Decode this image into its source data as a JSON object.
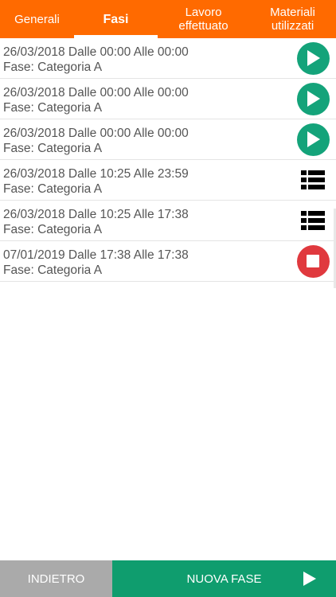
{
  "tabs": [
    {
      "label": "Generali"
    },
    {
      "label": "Fasi"
    },
    {
      "label": "Lavoro effettuato"
    },
    {
      "label": "Materiali utilizzati"
    }
  ],
  "active_tab": "Fasi",
  "colors": {
    "header": "#ff6a00",
    "play": "#14a37a",
    "stop": "#e0393e",
    "back_button": "#aaaaaa",
    "new_button": "#0f9d6e"
  },
  "phases": [
    {
      "line1": "26/03/2018 Dalle 00:00 Alle 00:00",
      "line2": "Fase: Categoria A",
      "action_icon": "play-icon"
    },
    {
      "line1": "26/03/2018 Dalle 00:00 Alle 00:00",
      "line2": "Fase: Categoria A",
      "action_icon": "play-icon"
    },
    {
      "line1": "26/03/2018 Dalle 00:00 Alle 00:00",
      "line2": "Fase: Categoria A",
      "action_icon": "play-icon"
    },
    {
      "line1": "26/03/2018 Dalle 10:25 Alle 23:59",
      "line2": "Fase: Categoria A",
      "action_icon": "list-icon"
    },
    {
      "line1": "26/03/2018 Dalle 10:25 Alle 17:38",
      "line2": "Fase: Categoria A",
      "action_icon": "list-icon"
    },
    {
      "line1": "07/01/2019 Dalle 17:38 Alle 17:38",
      "line2": "Fase: Categoria A",
      "action_icon": "stop-icon"
    }
  ],
  "bottom": {
    "back_label": "INDIETRO",
    "new_label": "NUOVA FASE"
  }
}
